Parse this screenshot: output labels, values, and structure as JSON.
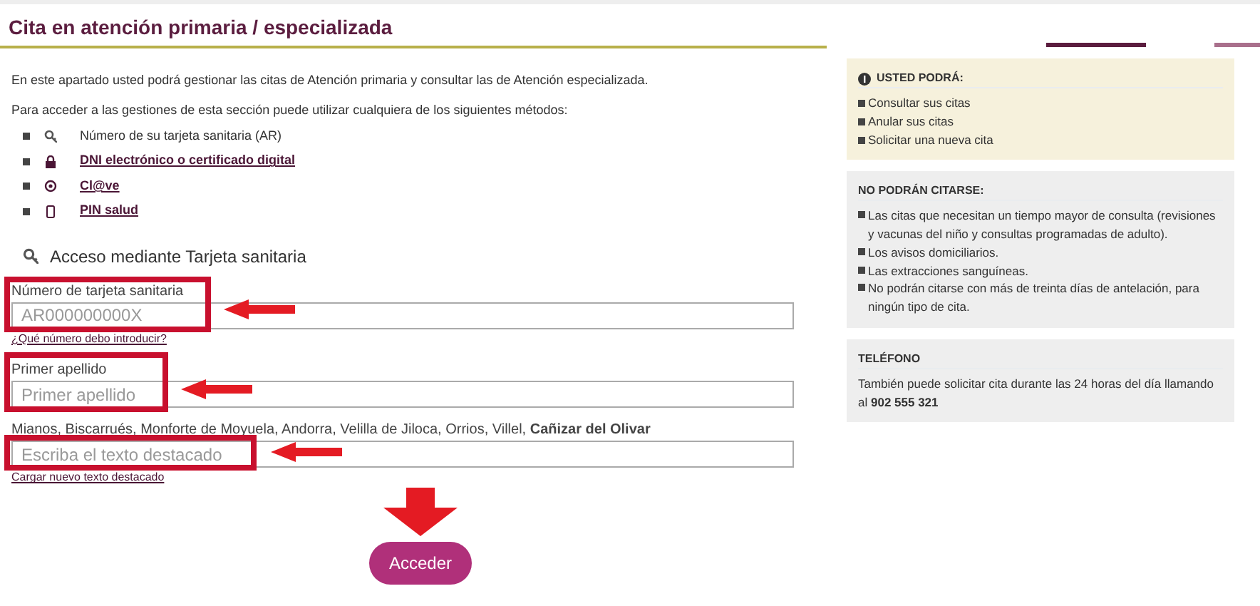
{
  "title": "Cita en atención primaria / especializada",
  "intro": "En este apartado usted podrá gestionar las citas de Atención primaria y consultar las de Atención especializada.",
  "methods_intro": "Para acceder a las gestiones de esta sección puede utilizar cualquiera de los siguientes métodos:",
  "methods": [
    {
      "label": "Número de su tarjeta sanitaria (AR)",
      "kind": "text"
    },
    {
      "label": "DNI electrónico o certificado digital",
      "kind": "link"
    },
    {
      "label": "Cl@ve",
      "kind": "link"
    },
    {
      "label": "PIN salud",
      "kind": "link"
    }
  ],
  "form": {
    "heading": "Acceso mediante Tarjeta sanitaria",
    "fields": [
      {
        "label": "Número de tarjeta sanitaria",
        "placeholder": "AR000000000X",
        "help": "¿Qué número debo introducir?"
      },
      {
        "label": "Primer apellido",
        "placeholder": "Primer apellido"
      },
      {
        "captcha": "Mianos, Biscarrués, Monforte de Moyuela, Andorra, Velilla de Jiloca, Orrios, Villel, **Cañizar del Olivar**",
        "placeholder": "Escriba el texto destacado",
        "help": "Cargar nuevo texto destacado"
      }
    ],
    "submit": "Acceder"
  },
  "sidebar": {
    "can": {
      "title": "USTED PODRÁ:",
      "items": [
        "Consultar sus citas",
        "Anular sus citas",
        "Solicitar una nueva cita"
      ]
    },
    "cannot": {
      "title": "NO PODRÁN CITARSE:",
      "items": [
        "Las citas que necesitan un tiempo mayor de consulta (revisiones y vacunas del niño y consultas programadas de adulto).",
        "Los avisos domiciliarios.",
        "Las extracciones sanguíneas.",
        "No podrán citarse con más de treinta días de antelación, para ningún tipo de cita."
      ]
    },
    "phone": {
      "title": "TELÉFONO",
      "text": "También puede solicitar cita durante las 24 horas del día llamando al **902 555 321**"
    }
  }
}
